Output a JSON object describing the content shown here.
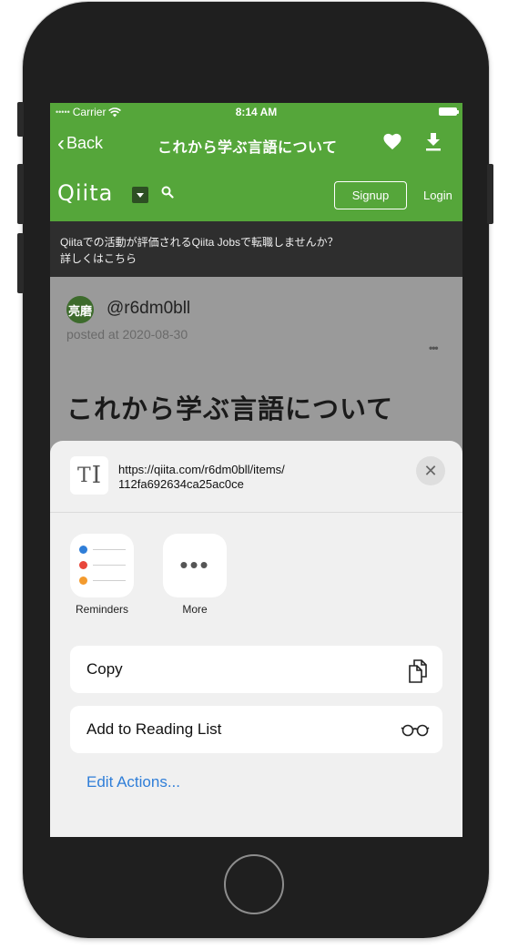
{
  "status_bar": {
    "carrier": "Carrier",
    "time": "8:14 AM"
  },
  "nav": {
    "back_label": "Back",
    "title": "これから学ぶ言語について",
    "heart_icon": "heart-icon",
    "download_icon": "download-icon"
  },
  "qiita_header": {
    "logo": "Qiita",
    "signup_label": "Signup",
    "login_label": "Login"
  },
  "banner": {
    "line1": "Qiitaでの活動が評価されるQiita Jobsで転職しませんか？",
    "line2": "詳しくはこちら"
  },
  "article": {
    "avatar_text": "亮磨",
    "username": "@r6dm0bll",
    "posted": "posted at 2020-08-30",
    "more": "•••",
    "title": "これから学ぶ言語について"
  },
  "share_sheet": {
    "url_line1": "https://qiita.com/r6dm0bll/items/",
    "url_line2": "112fa692634ca25ac0ce",
    "close_label": "✕",
    "apps": [
      {
        "label": "Reminders",
        "icon": "reminders-icon"
      },
      {
        "label": "More",
        "icon": "more-icon"
      }
    ],
    "actions": [
      {
        "label": "Copy",
        "icon": "copy-icon"
      },
      {
        "label": "Add to Reading List",
        "icon": "reading-list-glasses-icon"
      }
    ],
    "edit_actions_label": "Edit Actions..."
  },
  "colors": {
    "qiita_green": "#55a63a",
    "banner_bg": "#2e2e2e",
    "link_blue": "#2f7ed8",
    "reminder_dots": [
      "#2f7ed8",
      "#e8473c",
      "#f39a2d"
    ]
  }
}
